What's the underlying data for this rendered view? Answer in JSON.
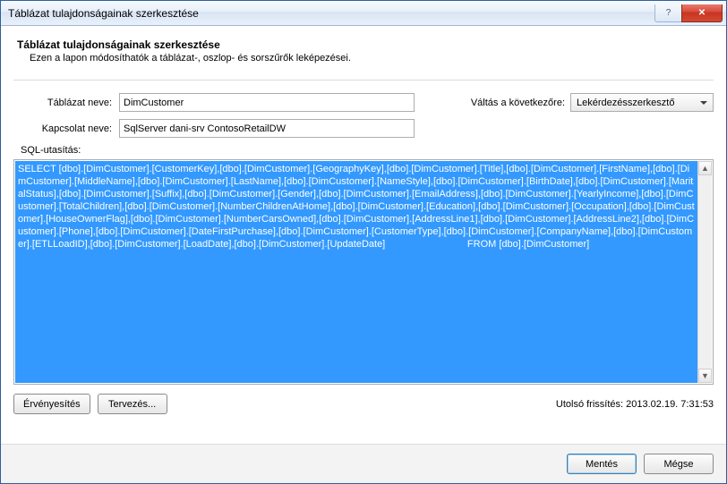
{
  "window": {
    "title": "Táblázat tulajdonságainak szerkesztése"
  },
  "section": {
    "heading": "Táblázat tulajdonságainak szerkesztése",
    "sub": "Ezen a lapon módosíthatók a táblázat-, oszlop- és sorszűrők leképezései."
  },
  "labels": {
    "table_name": "Táblázat neve:",
    "connection_name": "Kapcsolat neve:",
    "switch_to": "Váltás a következőre:",
    "sql_statement": "SQL-utasítás:"
  },
  "values": {
    "table_name": "DimCustomer",
    "connection_name": "SqlServer dani-srv ContosoRetailDW",
    "switch_to_selected": "Lekérdezésszerkesztő"
  },
  "sql": "SELECT [dbo].[DimCustomer].[CustomerKey],[dbo].[DimCustomer].[GeographyKey],[dbo].[DimCustomer].[Title],[dbo].[DimCustomer].[FirstName],[dbo].[DimCustomer].[MiddleName],[dbo].[DimCustomer].[LastName],[dbo].[DimCustomer].[NameStyle],[dbo].[DimCustomer].[BirthDate],[dbo].[DimCustomer].[MaritalStatus],[dbo].[DimCustomer].[Suffix],[dbo].[DimCustomer].[Gender],[dbo].[DimCustomer].[EmailAddress],[dbo].[DimCustomer].[YearlyIncome],[dbo].[DimCustomer].[TotalChildren],[dbo].[DimCustomer].[NumberChildrenAtHome],[dbo].[DimCustomer].[Education],[dbo].[DimCustomer].[Occupation],[dbo].[DimCustomer].[HouseOwnerFlag],[dbo].[DimCustomer].[NumberCarsOwned],[dbo].[DimCustomer].[AddressLine1],[dbo].[DimCustomer].[AddressLine2],[dbo].[DimCustomer].[Phone],[dbo].[DimCustomer].[DateFirstPurchase],[dbo].[DimCustomer].[CustomerType],[dbo].[DimCustomer].[CompanyName],[dbo].[DimCustomer].[ETLLoadID],[dbo].[DimCustomer].[LoadDate],[dbo].[DimCustomer].[UpdateDate]   FROM [dbo].[DimCustomer]",
  "buttons": {
    "validate": "Érvényesítés",
    "design": "Tervezés...",
    "save": "Mentés",
    "cancel": "Mégse"
  },
  "status": {
    "last_refresh": "Utolsó frissítés: 2013.02.19. 7:31:53"
  }
}
